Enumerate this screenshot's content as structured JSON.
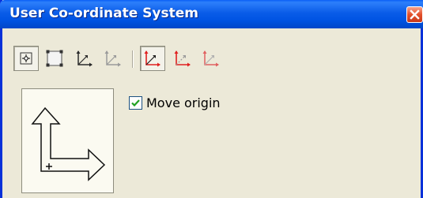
{
  "window": {
    "title": "User Co-ordinate System",
    "close_icon": "close-icon"
  },
  "toolbar": {
    "buttons": [
      {
        "icon": "origin-point-icon",
        "pressed": true
      },
      {
        "icon": "bounding-box-icon",
        "pressed": false
      },
      {
        "icon": "axes-black-icon",
        "pressed": false
      },
      {
        "icon": "axes-gray-icon",
        "pressed": false
      },
      {
        "icon": "axes-red-icon",
        "pressed": true
      },
      {
        "icon": "axes-red-dotted-icon",
        "pressed": false
      },
      {
        "icon": "axes-red-gray-icon",
        "pressed": false
      }
    ]
  },
  "options": {
    "move_origin_label": "Move origin",
    "move_origin_checked": true
  },
  "colors": {
    "titlebar": "#0054e3",
    "panel": "#ece9d8",
    "axis_red": "#e02020",
    "axis_gray": "#9a9a9a"
  }
}
